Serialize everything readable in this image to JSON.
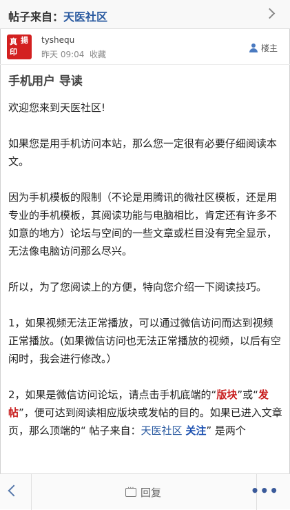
{
  "header": {
    "prefix": "帖子来自：",
    "forum_name": "天医社区"
  },
  "author": {
    "avatar_text": [
      "真",
      "揚",
      "印"
    ],
    "username": "tyshequ",
    "time": "昨天 09:04",
    "favorite_label": "收藏",
    "role_label": "楼主"
  },
  "post": {
    "title": "手机用户 导读",
    "p1": "欢迎您来到天医社区!",
    "p2": "如果您是用手机访问本站，那么您一定很有必要仔细阅读本文。",
    "p3": "因为手机模板的限制（不论是用腾讯的微社区模板，还是用专业的手机模板，其阅读功能与电脑相比，肯定还有许多不如意的地方）论坛与空间的一些文章或栏目没有完全显示，无法像电脑访问那么尽兴。",
    "p4": "所以，为了您阅读上的方便，特向您介绍一下阅读技巧。",
    "p5": "1，如果视频无法正常播放，可以通过微信访问而达到视频正常播放。(如果微信访问也无法正常播放的视频，以后有空闲时，我会进行修改。）",
    "p6": {
      "a": "2，如果是微信访问论坛，请点击手机底端的",
      "q1o": "“",
      "bankuai": "版块",
      "q1c": "”",
      "or": "或",
      "q2o": "“",
      "fatie": "发帖",
      "q2c": "”",
      "b": "，便可达到阅读相应版块或发帖的目的。如果已进入文章页，那么顶端的“ 帖子来自：",
      "forum": "天医社区",
      "follow": "关注",
      "c": "” 是两个"
    }
  },
  "bottom": {
    "reply_label": "回复",
    "more_label": "•••"
  },
  "colors": {
    "forum_link": "#2a5aa0",
    "highlight_red": "#c81e1e",
    "highlight_blue": "#1a4fb0",
    "avatar_bg": "#d32020"
  }
}
